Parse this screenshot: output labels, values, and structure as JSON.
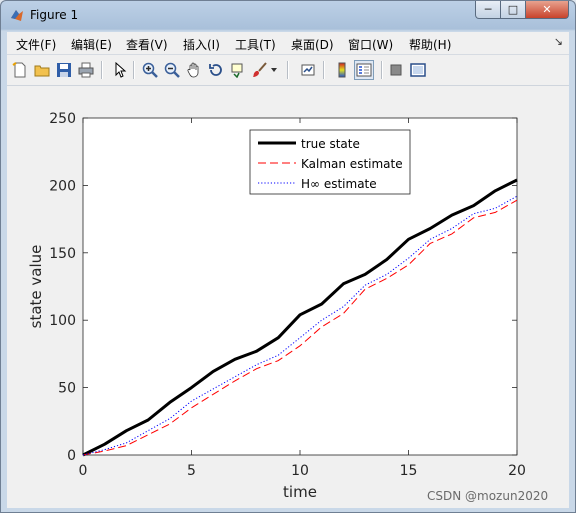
{
  "window": {
    "title": "Figure 1",
    "controls": {
      "minimize": "─",
      "maximize": "□",
      "close": "✕"
    }
  },
  "menubar": {
    "items": [
      {
        "label": "文件(F)"
      },
      {
        "label": "编辑(E)"
      },
      {
        "label": "查看(V)"
      },
      {
        "label": "插入(I)"
      },
      {
        "label": "工具(T)"
      },
      {
        "label": "桌面(D)"
      },
      {
        "label": "窗口(W)"
      },
      {
        "label": "帮助(H)"
      }
    ],
    "overflow_arrow": "↘"
  },
  "toolbar": {
    "icons": [
      "new-figure-icon",
      "open-file-icon",
      "save-icon",
      "print-icon",
      "edit-plot-arrow-icon",
      "zoom-in-icon",
      "zoom-out-icon",
      "pan-hand-icon",
      "rotate-3d-icon",
      "data-cursor-icon",
      "brush-icon",
      "brush-dropdown-icon",
      "link-plot-icon",
      "colorbar-icon",
      "legend-icon",
      "hide-plot-tools-icon",
      "show-plot-tools-icon"
    ]
  },
  "chart_data": {
    "type": "line",
    "xlabel": "time",
    "ylabel": "state value",
    "xlim": [
      0,
      20
    ],
    "ylim": [
      0,
      250
    ],
    "xticks": [
      0,
      5,
      10,
      15,
      20
    ],
    "yticks": [
      0,
      50,
      100,
      150,
      200,
      250
    ],
    "grid": false,
    "legend_position": "top",
    "x": [
      0,
      1,
      2,
      3,
      4,
      5,
      6,
      7,
      8,
      9,
      10,
      11,
      12,
      13,
      14,
      15,
      16,
      17,
      18,
      19,
      20
    ],
    "series": [
      {
        "name": "true state",
        "color": "#000000",
        "style": "solid",
        "values": [
          0,
          8,
          18,
          26,
          39,
          50,
          62,
          71,
          77,
          87,
          104,
          112,
          127,
          134,
          145,
          160,
          168,
          178,
          185,
          196,
          204
        ]
      },
      {
        "name": "Kalman estimate",
        "color": "#ff0000",
        "style": "dashed",
        "values": [
          0,
          3,
          7,
          15,
          23,
          35,
          45,
          55,
          64,
          70,
          81,
          95,
          105,
          123,
          131,
          141,
          157,
          164,
          176,
          180,
          189
        ]
      },
      {
        "name": "H∞ estimate",
        "color": "#0000ff",
        "style": "dotted",
        "values": [
          0,
          4,
          9,
          18,
          27,
          40,
          49,
          58,
          67,
          74,
          87,
          100,
          110,
          126,
          134,
          146,
          160,
          168,
          179,
          183,
          192
        ]
      }
    ]
  },
  "watermark": "CSDN @mozun2020"
}
